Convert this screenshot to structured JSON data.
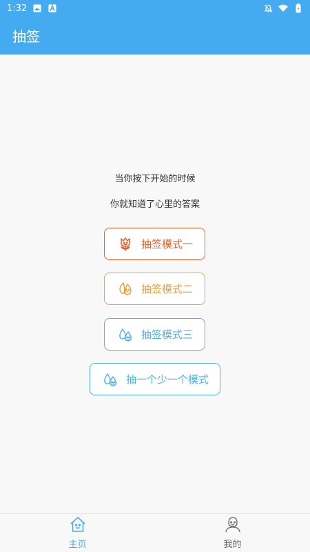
{
  "status_bar": {
    "time": "1:32",
    "icons": [
      "image-icon",
      "a-icon",
      "bell-off-icon",
      "wifi-icon",
      "battery-icon"
    ]
  },
  "app_bar": {
    "title": "抽签"
  },
  "main": {
    "line1": "当你按下开始的时候",
    "line2": "你就知道了心里的答案",
    "buttons": [
      {
        "label": "抽签模式一",
        "icon": "flower-icon",
        "color": "#e2622f"
      },
      {
        "label": "抽签模式二",
        "icon": "leaf-icon",
        "color": "#f0a03a"
      },
      {
        "label": "抽签模式三",
        "icon": "water-drop-icon",
        "color": "#4fb2ee"
      },
      {
        "label": "抽一个少一个模式",
        "icon": "water-drop-icon",
        "color": "#4fb2ee"
      }
    ]
  },
  "tab_bar": {
    "items": [
      {
        "label": "主页",
        "icon": "home-icon",
        "active": true
      },
      {
        "label": "我的",
        "icon": "person-icon",
        "active": false
      }
    ]
  },
  "colors": {
    "accent": "#45abf0",
    "background": "#f8f8f8"
  }
}
